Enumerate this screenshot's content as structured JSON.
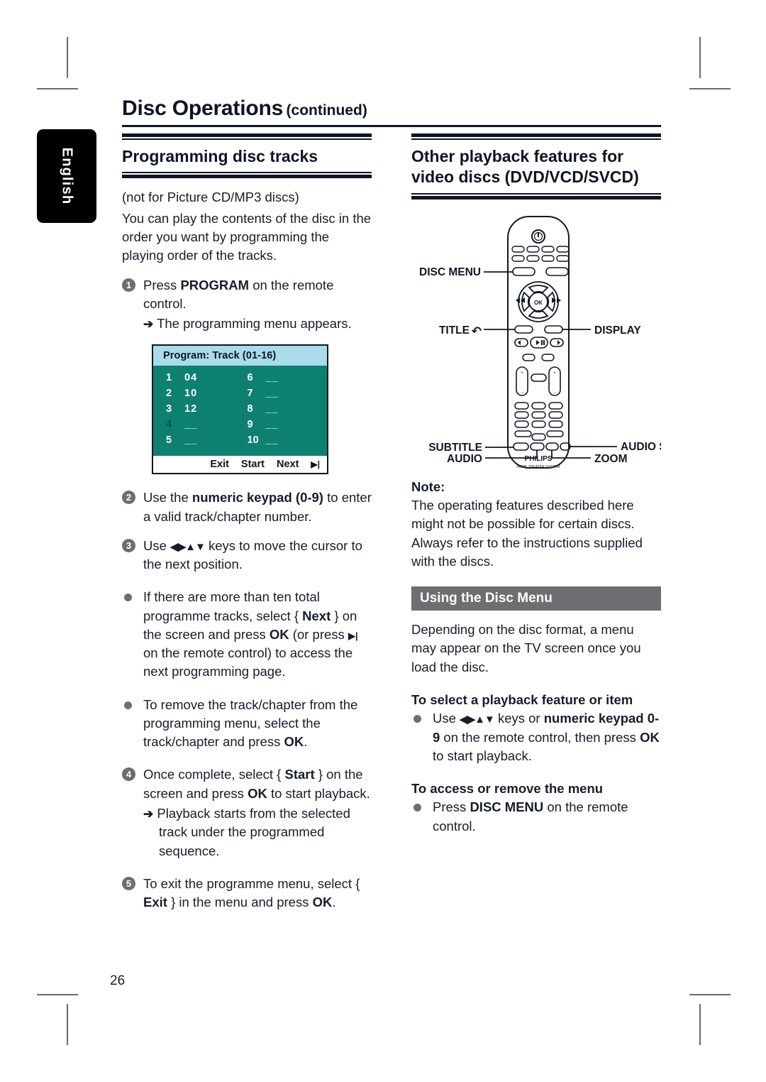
{
  "crop_marks": true,
  "language_tab": {
    "label": "English"
  },
  "header": {
    "title": "Disc Operations",
    "continued": "(continued)"
  },
  "page_number": "26",
  "left_column": {
    "heading": "Programming disc tracks",
    "intro_line1": "(not for Picture CD/MP3 discs)",
    "intro_line2": "You can play the contents of the disc in the order you want by programming the playing order of the tracks.",
    "step1": {
      "number": "1",
      "text_pre": "Press ",
      "text_bold": "PROGRAM",
      "text_post": " on the remote control.",
      "result_arrow": "➔",
      "result": "The programming menu appears."
    },
    "program_menu": {
      "title": "Program: Track (01-16)",
      "rows_left": [
        {
          "index": "1",
          "value": "04"
        },
        {
          "index": "2",
          "value": "10"
        },
        {
          "index": "3",
          "value": "12"
        },
        {
          "index": "4",
          "value": "__"
        },
        {
          "index": "5",
          "value": "__"
        }
      ],
      "rows_right": [
        {
          "index": "6",
          "value": "__"
        },
        {
          "index": "7",
          "value": "__"
        },
        {
          "index": "8",
          "value": "__"
        },
        {
          "index": "9",
          "value": "__"
        },
        {
          "index": "10",
          "value": "__"
        }
      ],
      "cursor_row_index": "4",
      "footer": {
        "exit": "Exit",
        "start": "Start",
        "next": "Next",
        "next_icon": "▶|"
      },
      "colors": {
        "header_bg": "#a9dbeb",
        "body_bg": "#0d8070",
        "footer_bg": "#ffffff",
        "border": "#0e1422"
      }
    },
    "step2": {
      "number": "2",
      "text_pre": "Use the ",
      "text_bold": "numeric keypad (0-9)",
      "text_post": " to enter a valid track/chapter number."
    },
    "step3": {
      "number": "3",
      "text_pre": "Use ",
      "keys": "◀▶▲▼",
      "text_post": " keys to move the cursor to the next position."
    },
    "bullet1": {
      "seg1": "If there are more than ten total programme tracks, select { ",
      "bold1": "Next",
      "seg2": " } on the screen and press ",
      "bold2": "OK",
      "seg3": " (or press ",
      "icon": "▶|",
      "seg4": " on the remote control) to access the next programming page."
    },
    "bullet2": {
      "seg1": "To remove the track/chapter from the programming menu, select the track/chapter and press ",
      "bold1": "OK",
      "seg2": "."
    },
    "step4": {
      "number": "4",
      "seg1": "Once complete, select { ",
      "bold1": "Start",
      "seg2": " } on the screen and press ",
      "bold2": "OK",
      "seg3": " to start playback.",
      "result_arrow": "➔",
      "result": "Playback starts from the selected track under the programmed sequence."
    },
    "step5": {
      "number": "5",
      "seg1": "To exit the programme menu, select { ",
      "bold1": "Exit",
      "seg2": " } in the menu and press ",
      "bold2": "OK",
      "seg3": "."
    }
  },
  "right_column": {
    "heading": "Other playback features for video discs (DVD/VCD/SVCD)",
    "remote": {
      "brand": "PHILIPS",
      "subbrand": "HOME THEATER SYSTEM",
      "ok_label": "OK",
      "callouts_left": [
        "DISC MENU",
        "TITLE",
        "SUBTITLE",
        "AUDIO"
      ],
      "title_icon": "↶",
      "callouts_right": [
        "DISPLAY",
        "AUDIO SYNC",
        "ZOOM"
      ]
    },
    "note": {
      "label": "Note:",
      "text": "The operating features described here might not be possible for certain discs. Always refer to the instructions supplied with the discs."
    },
    "disc_menu_bar": "Using the Disc Menu",
    "disc_menu_para": "Depending on the disc format, a menu may appear on the TV screen once you load the disc.",
    "select_feature": {
      "heading": "To select a playback feature or item",
      "seg1": "Use ",
      "keys": "◀▶▲▼",
      "seg2": " keys or ",
      "bold1": "numeric keypad",
      "seg3": " ",
      "bold2": "0-9",
      "seg4": " on the remote control, then press ",
      "bold3": "OK",
      "seg5": " to start playback."
    },
    "access_menu": {
      "heading": "To access or remove the menu",
      "seg1": "Press ",
      "bold1": "DISC MENU",
      "seg2": " on the remote control."
    }
  }
}
